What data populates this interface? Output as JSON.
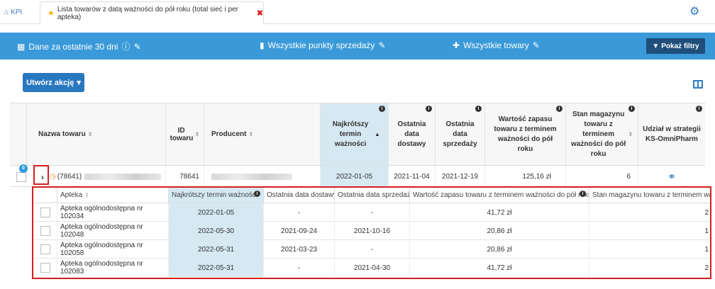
{
  "tabs": {
    "kpi_label": "KPI",
    "active_label": "Lista towarów z datą ważności do pół roku (total sieć i per apteka)",
    "close_glyph": "✖"
  },
  "filters": {
    "period": "Dane za ostatnie 30 dni",
    "points": "Wszystkie punkty sprzedaży",
    "products": "Wszystkie towary",
    "show_filters": "Pokaż filtry"
  },
  "toolbar": {
    "create_action": "Utwórz akcję"
  },
  "table": {
    "headers": {
      "name": "Nazwa towaru",
      "id": "ID towaru",
      "producer": "Producent",
      "shortest_expiry": "Najkrótszy termin ważności",
      "last_delivery": "Ostatnia data dostawy",
      "last_sale": "Ostatnia data sprzedaży",
      "stock_value": "Wartość zapasu towaru z terminem ważności do pół roku",
      "stock_qty": "Stan magazynu towaru z terminem ważności do pół roku",
      "strategy_share": "Udział w strategii KS-OmniPharm"
    },
    "row": {
      "badge": "0",
      "name_prefix": "(78641)",
      "id": "78641",
      "shortest_expiry": "2022-01-05",
      "last_delivery": "2021-11-04",
      "last_sale": "2021-12-19",
      "stock_value": "125,16 zł",
      "stock_qty": "6"
    }
  },
  "nested": {
    "headers": {
      "pharmacy": "Apteka",
      "shortest_expiry": "Najkrótszy termin ważności",
      "last_delivery": "Ostatnia data dostawy",
      "last_sale": "Ostatnia data sprzedaży",
      "stock_value": "Wartość zapasu towaru z terminem ważności do pół roku",
      "stock_qty": "Stan magazynu towaru z terminem wa"
    },
    "rows": [
      {
        "pharmacy": "Apteka ogólnodostępna nr 102034",
        "expiry": "2022-01-05",
        "delivery": "-",
        "sale": "-",
        "value": "41,72 zł",
        "qty": "2"
      },
      {
        "pharmacy": "Apteka ogólnodostępna nr 102048",
        "expiry": "2022-05-30",
        "delivery": "2021-09-24",
        "sale": "2021-10-16",
        "value": "20,86 zł",
        "qty": "1"
      },
      {
        "pharmacy": "Apteka ogólnodostępna nr 102058",
        "expiry": "2022-05-31",
        "delivery": "2021-03-23",
        "sale": "-",
        "value": "20,86 zł",
        "qty": "1"
      },
      {
        "pharmacy": "Apteka ogólnodostępna nr 102083",
        "expiry": "2022-05-31",
        "delivery": "-",
        "sale": "2021-04-30",
        "value": "41,72 zł",
        "qty": "2"
      }
    ]
  }
}
